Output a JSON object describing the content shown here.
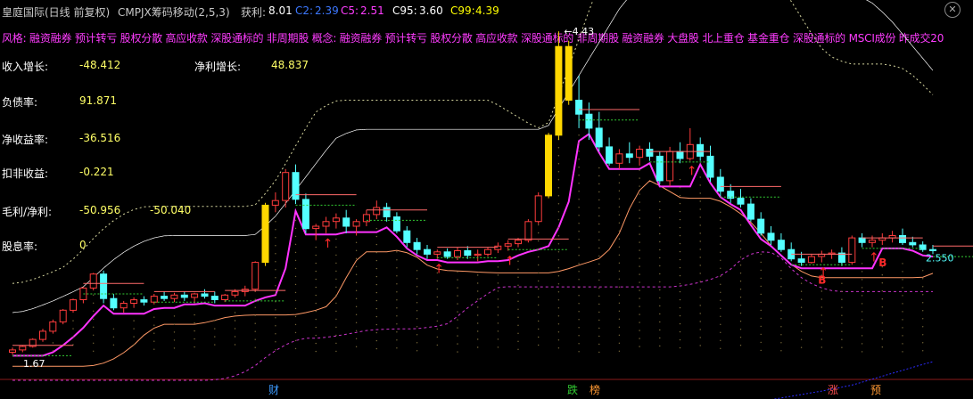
{
  "header": {
    "title": "皇庭国际(日线 前复权)",
    "indicator_name": "CMPJX筹码移动(2,5,3)",
    "profit_label": "获利:",
    "profit_value": "8.01",
    "c2_label": "C2:",
    "c2_value": "2.39",
    "c5_label": "C5:",
    "c5_value": "2.51",
    "c95_label": "C95:",
    "c95_value": "3.60",
    "c99_label": "C99:",
    "c99_value": "4.39",
    "colors": {
      "title": "#c8c8c8",
      "c2": "#3c78ff",
      "c5": "#ff3cff",
      "c95": "#ffffff",
      "c99": "#ffff00"
    }
  },
  "concept_line": "风格: 融资融券 预计转亏 股权分散 高应收款 深股通标的 非周期股 概念: 融资融券 预计转亏 股权分散 高应收款 深股通标的 非周期股 融资融券 大盘股 北上重仓 基金重仓 深股通标的 MSCI成份 昨成交20",
  "financials": [
    {
      "label": "收入增长:",
      "value": "-48.412"
    },
    {
      "label": "净利增长:",
      "value": "48.837"
    },
    {
      "label": "负债率:",
      "value": "91.871"
    },
    {
      "label": "净收益率:",
      "value": "-36.516"
    },
    {
      "label": "扣非收益:",
      "value": "-0.221"
    },
    {
      "label": "毛利/净利:",
      "value": "-50.956"
    },
    {
      "label": "",
      "value": "-50.040"
    },
    {
      "label": "股息率:",
      "value": "0"
    }
  ],
  "annotations": {
    "high_label": "4.43",
    "low_label": "1.67",
    "last_label": "2.550",
    "buy_marker": "B"
  },
  "bottom_markers": [
    {
      "text": "财",
      "color": "#3c9bff"
    },
    {
      "text": "跌",
      "color": "#33cc33"
    },
    {
      "text": "榜",
      "color": "#ff9933"
    },
    {
      "text": "涨",
      "color": "#ff5050"
    },
    {
      "text": "预",
      "color": "#ff9933"
    }
  ],
  "chart_data": {
    "type": "candlestick",
    "ylim": [
      1.6,
      4.5
    ],
    "grid": false,
    "candles": [
      [
        1.68,
        1.72,
        1.66,
        1.7
      ],
      [
        1.7,
        1.74,
        1.68,
        1.73
      ],
      [
        1.73,
        1.8,
        1.72,
        1.79
      ],
      [
        1.79,
        1.88,
        1.77,
        1.86
      ],
      [
        1.86,
        1.96,
        1.84,
        1.94
      ],
      [
        1.94,
        2.05,
        1.92,
        2.04
      ],
      [
        2.04,
        2.14,
        2.02,
        2.13
      ],
      [
        2.13,
        2.24,
        2.1,
        2.23
      ],
      [
        2.23,
        2.36,
        2.21,
        2.35
      ],
      [
        2.35,
        2.38,
        2.1,
        2.14
      ],
      [
        2.14,
        2.18,
        2.04,
        2.06
      ],
      [
        2.06,
        2.12,
        2.02,
        2.1
      ],
      [
        2.1,
        2.15,
        2.06,
        2.13
      ],
      [
        2.13,
        2.16,
        2.08,
        2.11
      ],
      [
        2.11,
        2.18,
        2.09,
        2.16
      ],
      [
        2.16,
        2.2,
        2.12,
        2.14
      ],
      [
        2.14,
        2.19,
        2.11,
        2.17
      ],
      [
        2.17,
        2.2,
        2.12,
        2.15
      ],
      [
        2.15,
        2.19,
        2.1,
        2.18
      ],
      [
        2.18,
        2.22,
        2.14,
        2.16
      ],
      [
        2.16,
        2.2,
        2.1,
        2.13
      ],
      [
        2.13,
        2.18,
        2.11,
        2.17
      ],
      [
        2.17,
        2.22,
        2.15,
        2.2
      ],
      [
        2.2,
        2.25,
        2.16,
        2.22
      ],
      [
        2.22,
        2.46,
        2.2,
        2.45
      ],
      [
        2.45,
        2.96,
        2.42,
        2.94
      ],
      [
        2.94,
        3.05,
        2.88,
        2.98
      ],
      [
        2.98,
        3.25,
        2.92,
        3.22
      ],
      [
        3.22,
        3.29,
        2.95,
        2.99
      ],
      [
        2.99,
        3.04,
        2.7,
        2.74
      ],
      [
        2.74,
        2.78,
        2.64,
        2.76
      ],
      [
        2.76,
        2.84,
        2.7,
        2.8
      ],
      [
        2.8,
        2.87,
        2.74,
        2.83
      ],
      [
        2.83,
        2.9,
        2.7,
        2.76
      ],
      [
        2.76,
        2.82,
        2.68,
        2.8
      ],
      [
        2.8,
        2.9,
        2.76,
        2.86
      ],
      [
        2.86,
        2.98,
        2.82,
        2.92
      ],
      [
        2.92,
        2.96,
        2.8,
        2.84
      ],
      [
        2.84,
        2.88,
        2.7,
        2.72
      ],
      [
        2.72,
        2.76,
        2.58,
        2.62
      ],
      [
        2.62,
        2.66,
        2.52,
        2.56
      ],
      [
        2.56,
        2.6,
        2.48,
        2.52
      ],
      [
        2.52,
        2.56,
        2.48,
        2.54
      ],
      [
        2.54,
        2.57,
        2.48,
        2.5
      ],
      [
        2.5,
        2.58,
        2.47,
        2.55
      ],
      [
        2.55,
        2.59,
        2.48,
        2.51
      ],
      [
        2.51,
        2.56,
        2.46,
        2.52
      ],
      [
        2.52,
        2.58,
        2.5,
        2.56
      ],
      [
        2.56,
        2.62,
        2.53,
        2.59
      ],
      [
        2.59,
        2.64,
        2.55,
        2.61
      ],
      [
        2.61,
        2.66,
        2.58,
        2.64
      ],
      [
        2.64,
        2.82,
        2.62,
        2.8
      ],
      [
        2.8,
        3.05,
        2.78,
        3.02
      ],
      [
        3.02,
        3.56,
        3.0,
        3.54
      ],
      [
        3.54,
        4.43,
        3.5,
        4.3
      ],
      [
        4.3,
        4.35,
        3.8,
        3.84
      ],
      [
        3.84,
        4.05,
        3.6,
        3.72
      ],
      [
        3.72,
        3.82,
        3.5,
        3.6
      ],
      [
        3.6,
        3.74,
        3.4,
        3.44
      ],
      [
        3.44,
        3.52,
        3.28,
        3.3
      ],
      [
        3.3,
        3.42,
        3.25,
        3.38
      ],
      [
        3.38,
        3.48,
        3.3,
        3.35
      ],
      [
        3.35,
        3.45,
        3.28,
        3.42
      ],
      [
        3.42,
        3.48,
        3.32,
        3.36
      ],
      [
        3.36,
        3.4,
        3.12,
        3.15
      ],
      [
        3.15,
        3.44,
        3.1,
        3.4
      ],
      [
        3.4,
        3.48,
        3.3,
        3.34
      ],
      [
        3.34,
        3.6,
        3.32,
        3.46
      ],
      [
        3.46,
        3.52,
        3.32,
        3.36
      ],
      [
        3.36,
        3.45,
        3.14,
        3.18
      ],
      [
        3.18,
        3.25,
        3.02,
        3.06
      ],
      [
        3.06,
        3.12,
        2.96,
        3.0
      ],
      [
        3.0,
        3.08,
        2.92,
        2.95
      ],
      [
        2.95,
        3.0,
        2.8,
        2.82
      ],
      [
        2.82,
        2.88,
        2.68,
        2.7
      ],
      [
        2.7,
        2.76,
        2.6,
        2.64
      ],
      [
        2.64,
        2.7,
        2.54,
        2.56
      ],
      [
        2.56,
        2.62,
        2.46,
        2.48
      ],
      [
        2.48,
        2.54,
        2.42,
        2.45
      ],
      [
        2.45,
        2.52,
        2.44,
        2.5
      ],
      [
        2.5,
        2.55,
        2.45,
        2.52
      ],
      [
        2.52,
        2.56,
        2.48,
        2.53
      ],
      [
        2.53,
        2.58,
        2.42,
        2.45
      ],
      [
        2.45,
        2.68,
        2.43,
        2.66
      ],
      [
        2.66,
        2.7,
        2.58,
        2.62
      ],
      [
        2.62,
        2.68,
        2.58,
        2.64
      ],
      [
        2.64,
        2.7,
        2.6,
        2.66
      ],
      [
        2.66,
        2.72,
        2.62,
        2.68
      ],
      [
        2.68,
        2.74,
        2.6,
        2.62
      ],
      [
        2.62,
        2.67,
        2.58,
        2.6
      ],
      [
        2.6,
        2.63,
        2.54,
        2.56
      ],
      [
        2.56,
        2.6,
        2.52,
        2.55
      ]
    ],
    "series": [
      {
        "name": "C2",
        "color": "#3c78ff"
      },
      {
        "name": "C5",
        "color": "#ff3cff"
      },
      {
        "name": "C95",
        "color": "#ffffff"
      },
      {
        "name": "C99",
        "color": "#ffff00"
      }
    ]
  }
}
